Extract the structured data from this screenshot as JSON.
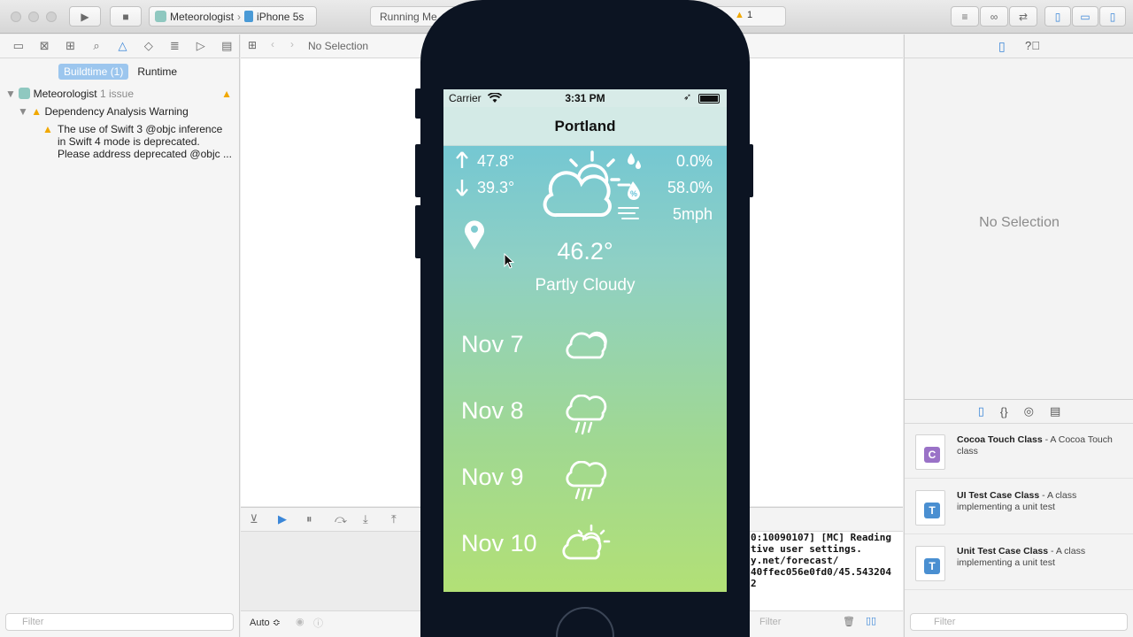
{
  "toolbar": {
    "scheme_app": "Meteorologist",
    "scheme_device": "iPhone 5s",
    "activity": "Running Me",
    "warning_count": "1"
  },
  "navigator": {
    "tabs": {
      "buildtime": "Buildtime (1)",
      "runtime": "Runtime"
    },
    "tree": {
      "project": "Meteorologist",
      "project_issues": "1 issue",
      "group": "Dependency Analysis Warning",
      "message_lines": [
        "The use of Swift 3 @objc inference",
        "in Swift 4 mode is deprecated.",
        "Please address deprecated @objc ..."
      ]
    },
    "filter_placeholder": "Filter"
  },
  "editor": {
    "jumpbar_text": "No Selection"
  },
  "debug": {
    "auto_label": "Auto ≎",
    "filter_placeholder": "Filter",
    "console_lines": [
      "0:10090107] [MC] Reading",
      "tive user settings.",
      "y.net/forecast/",
      "40ffec056e0fd0/45.543204",
      "2"
    ]
  },
  "inspector": {
    "no_selection": "No Selection",
    "library": [
      {
        "title": "Cocoa Touch Class",
        "desc": " - A Cocoa Touch class",
        "badge": "C",
        "color": "#9a72c7"
      },
      {
        "title": "UI Test Case Class",
        "desc": " - A class implementing a unit test",
        "badge": "T",
        "color": "#4a8fd1"
      },
      {
        "title": "Unit Test Case Class",
        "desc": " - A class implementing a unit test",
        "badge": "T",
        "color": "#4a8fd1"
      }
    ],
    "filter_placeholder": "Filter"
  },
  "app": {
    "status": {
      "carrier": "Carrier",
      "time": "3:31 PM"
    },
    "city": "Portland",
    "high": "47.8°",
    "low": "39.3°",
    "precip": "0.0%",
    "humidity": "58.0%",
    "wind": "5mph",
    "temp": "46.2°",
    "summary": "Partly Cloudy",
    "forecast": [
      {
        "date": "Nov 7",
        "icon": "cloud-icon"
      },
      {
        "date": "Nov 8",
        "icon": "rain-cloud-icon"
      },
      {
        "date": "Nov 9",
        "icon": "rain-cloud-icon"
      },
      {
        "date": "Nov 10",
        "icon": "partly-sunny-icon"
      }
    ]
  }
}
